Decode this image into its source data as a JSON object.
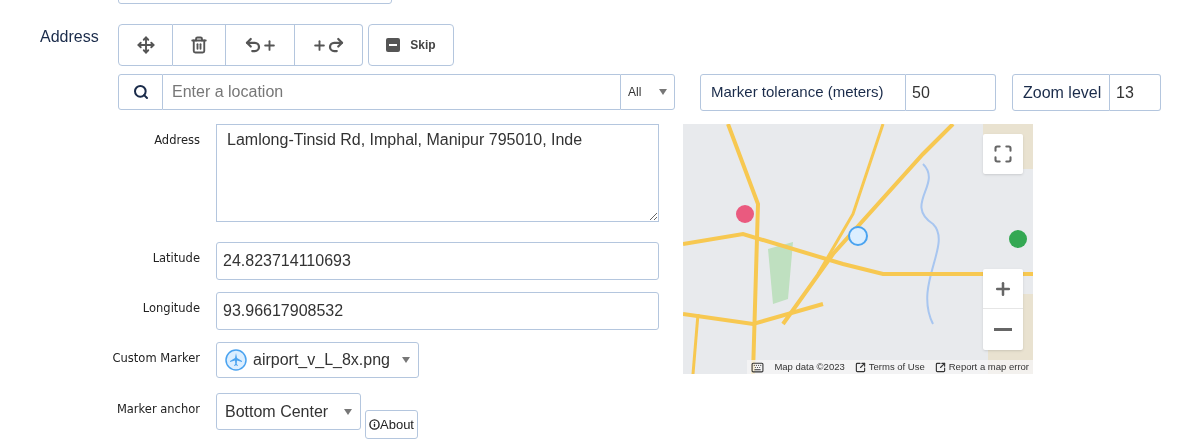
{
  "field_label": "Address",
  "toolbar": {
    "skip_label": "Skip"
  },
  "search": {
    "placeholder": "Enter a location",
    "filter": "All"
  },
  "marker_tolerance": {
    "label": "Marker tolerance (meters)",
    "value": "50"
  },
  "zoom_level": {
    "label": "Zoom level",
    "value": "13"
  },
  "fields": [
    {
      "kind": "textarea",
      "label": "Address",
      "value": "Lamlong-Tinsid Rd, Imphal, Manipur 795010, Inde"
    },
    {
      "kind": "text",
      "label": "Latitude",
      "value": "24.823714110693"
    },
    {
      "kind": "text",
      "label": "Longitude",
      "value": "93.96617908532"
    },
    {
      "kind": "icon-select",
      "label": "Custom Marker",
      "value": "airport_v_L_8x.png"
    },
    {
      "kind": "select",
      "label": "Marker anchor",
      "value": "Bottom Center",
      "button": "About"
    }
  ],
  "map": {
    "data": "Map data ©2023",
    "terms": "Terms of Use",
    "report": "Report a map error"
  }
}
